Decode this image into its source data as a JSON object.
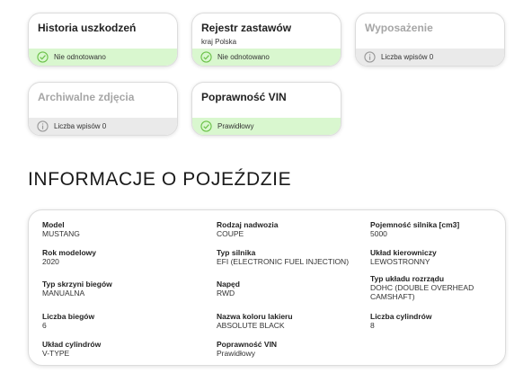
{
  "cards": [
    {
      "title": "Historia uszkodzeń",
      "subtitle": "",
      "status": "Nie odnotowano",
      "type": "ok"
    },
    {
      "title": "Rejestr zastawów",
      "subtitle": "kraj Polska",
      "status": "Nie odnotowano",
      "type": "ok"
    },
    {
      "title": "Wyposażenie",
      "subtitle": "",
      "status": "Liczba wpisów 0",
      "type": "info"
    },
    {
      "title": "Archiwalne zdjęcia",
      "subtitle": "",
      "status": "Liczba wpisów 0",
      "type": "info"
    },
    {
      "title": "Poprawność VIN",
      "subtitle": "",
      "status": "Prawidłowy",
      "type": "ok"
    }
  ],
  "section_title": "INFORMACJE O POJEŹDZIE",
  "vehicle": {
    "model": {
      "label": "Model",
      "value": "MUSTANG"
    },
    "body_type": {
      "label": "Rodzaj nadwozia",
      "value": "COUPE"
    },
    "engine_capacity": {
      "label": "Pojemność silnika [cm3]",
      "value": "5000"
    },
    "model_year": {
      "label": "Rok modelowy",
      "value": "2020"
    },
    "engine_type": {
      "label": "Typ silnika",
      "value": "EFI (ELECTRONIC FUEL INJECTION)"
    },
    "steering": {
      "label": "Układ kierowniczy",
      "value": "LEWOSTRONNY"
    },
    "gearbox": {
      "label": "Typ skrzyni biegów",
      "value": "MANUALNA"
    },
    "drive": {
      "label": "Napęd",
      "value": "RWD"
    },
    "timing": {
      "label": "Typ układu rozrządu",
      "value": "DOHC (DOUBLE OVERHEAD CAMSHAFT)"
    },
    "gears": {
      "label": "Liczba biegów",
      "value": "6"
    },
    "color": {
      "label": "Nazwa koloru lakieru",
      "value": "ABSOLUTE BLACK"
    },
    "cylinders": {
      "label": "Liczba cylindrów",
      "value": "8"
    },
    "cylinder_layout": {
      "label": "Układ cylindrów",
      "value": "V-TYPE"
    },
    "vin_validity": {
      "label": "Poprawność VIN",
      "value": "Prawidłowy"
    }
  },
  "colors": {
    "ok_bg": "#d9f7cf",
    "ok_icon": "#6cc24a",
    "info_bg": "#eaeaea",
    "info_icon": "#9a9a9a"
  },
  "icons": {
    "ok": "check-circle-icon",
    "info": "info-circle-icon"
  }
}
